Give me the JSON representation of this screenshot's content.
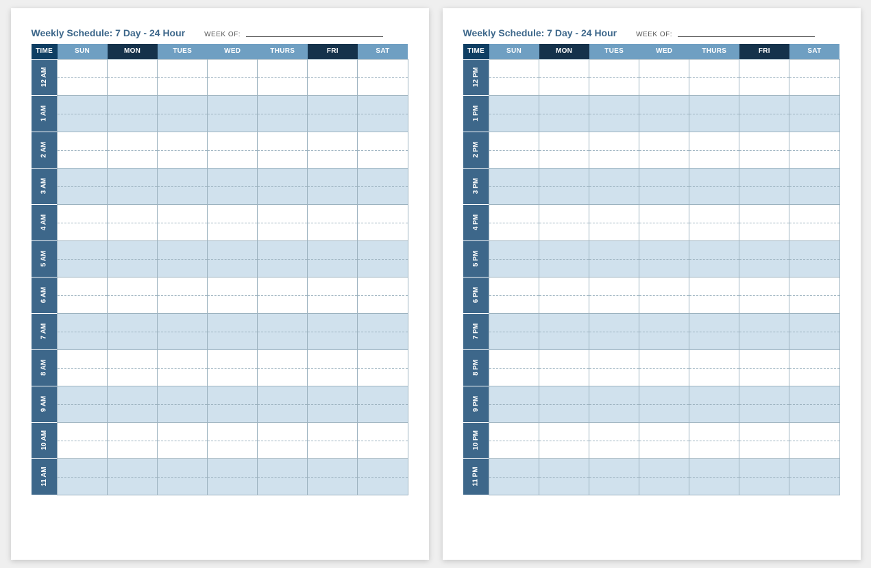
{
  "title": "Weekly Schedule: 7 Day - 24 Hour",
  "weekOfLabel": "WEEK OF:",
  "headers": {
    "time": "TIME",
    "days": [
      "SUN",
      "MON",
      "TUES",
      "WED",
      "THURS",
      "FRI",
      "SAT"
    ]
  },
  "headerShadePattern": [
    "light",
    "dark",
    "light",
    "light",
    "light",
    "dark",
    "light"
  ],
  "pages": [
    {
      "hours": [
        "12 AM",
        "1 AM",
        "2 AM",
        "3 AM",
        "4 AM",
        "5 AM",
        "6 AM",
        "7 AM",
        "8 AM",
        "9 AM",
        "10 AM",
        "11 AM"
      ]
    },
    {
      "hours": [
        "12 PM",
        "1 PM",
        "2 PM",
        "3 PM",
        "4 PM",
        "5 PM",
        "6 PM",
        "7 PM",
        "8 PM",
        "9 PM",
        "10 PM",
        "11 PM"
      ]
    }
  ]
}
